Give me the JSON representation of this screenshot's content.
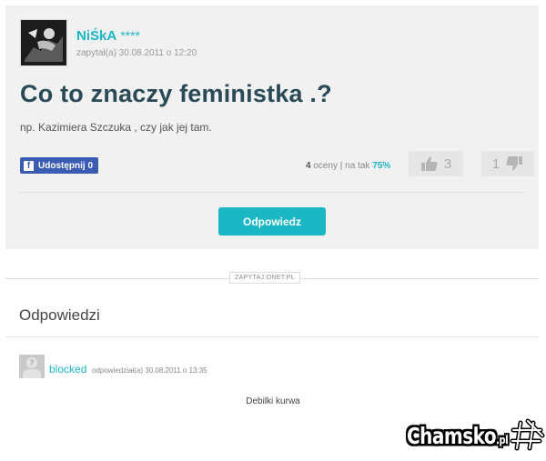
{
  "question": {
    "user_name": "NiŚkA",
    "user_stars": "****",
    "asked_meta": "zapytał(a) 30.08.2011 o 12:20",
    "title": "Co to znaczy feministka .?",
    "body": "np. Kazimiera Szczuka , czy jak jej tam.",
    "share_label": "Udostępnij 0",
    "rating": {
      "count": "4",
      "count_suffix": "oceny | na tak",
      "percent": "75%",
      "up_count": "3",
      "down_count": "1"
    },
    "answer_button": "Odpowiedz"
  },
  "source_tag": "ZAPYTAJ.ONET.PL",
  "answers": {
    "heading": "Odpowiedzi",
    "items": [
      {
        "user": "blocked",
        "meta": "odpowiedział(a) 30.08.2011 o 13:35",
        "text": "Debilki kurwa"
      }
    ]
  },
  "watermark": {
    "brand": "Chamsko",
    "tld": ".pl"
  },
  "colors": {
    "accent": "#1bb7c4",
    "facebook": "#3b5cb3",
    "title": "#2b4a58"
  },
  "icons": [
    "user-avatar-image",
    "facebook-icon",
    "thumb-up-icon",
    "thumb-down-icon",
    "default-avatar-icon",
    "hashtag-logo-icon"
  ]
}
